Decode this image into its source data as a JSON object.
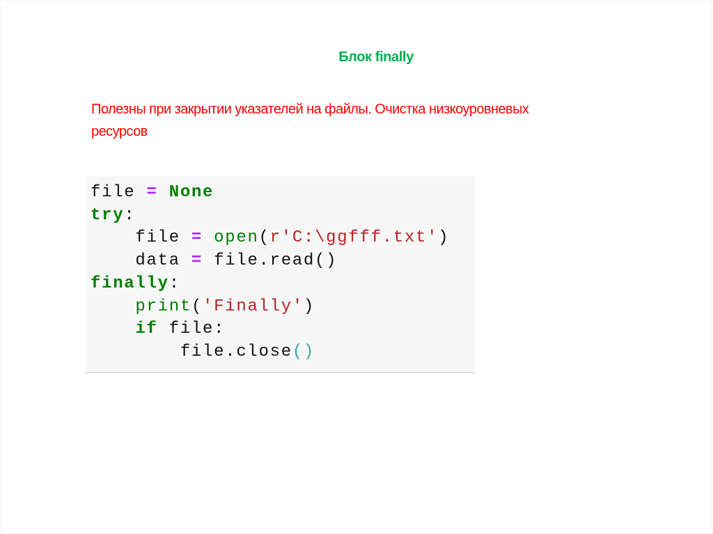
{
  "slide": {
    "title": "Блок finally",
    "description": "Полезны при закрытии указателей на файлы. Очистка низкоуровневых ресурсов"
  },
  "code": {
    "colors": {
      "keyword": "#008000",
      "operator": "#AA22FF",
      "string": "#BA2121",
      "text": "#111111"
    },
    "lines": [
      [
        [
          "tx",
          "file "
        ],
        [
          "op",
          "="
        ],
        [
          "tx",
          " "
        ],
        [
          "kw",
          "None"
        ]
      ],
      [
        [
          "kw",
          "try"
        ],
        [
          "tx",
          ":"
        ]
      ],
      [
        [
          "tx",
          "    file "
        ],
        [
          "op",
          "="
        ],
        [
          "tx",
          " "
        ],
        [
          "bi",
          "open"
        ],
        [
          "tx",
          "("
        ],
        [
          "st",
          "r'C:\\ggfff.txt'"
        ],
        [
          "tx",
          ")"
        ]
      ],
      [
        [
          "tx",
          "    data "
        ],
        [
          "op",
          "="
        ],
        [
          "tx",
          " file.read()"
        ]
      ],
      [
        [
          "kw",
          "finally"
        ],
        [
          "tx",
          ":"
        ]
      ],
      [
        [
          "tx",
          "    "
        ],
        [
          "bi",
          "print"
        ],
        [
          "tx",
          "("
        ],
        [
          "st",
          "'Finally'"
        ],
        [
          "tx",
          ")"
        ]
      ],
      [
        [
          "tx",
          "    "
        ],
        [
          "kw",
          "if"
        ],
        [
          "tx",
          " file:"
        ]
      ],
      [
        [
          "tx",
          "        file.close"
        ],
        [
          "pc",
          "()"
        ]
      ]
    ]
  }
}
